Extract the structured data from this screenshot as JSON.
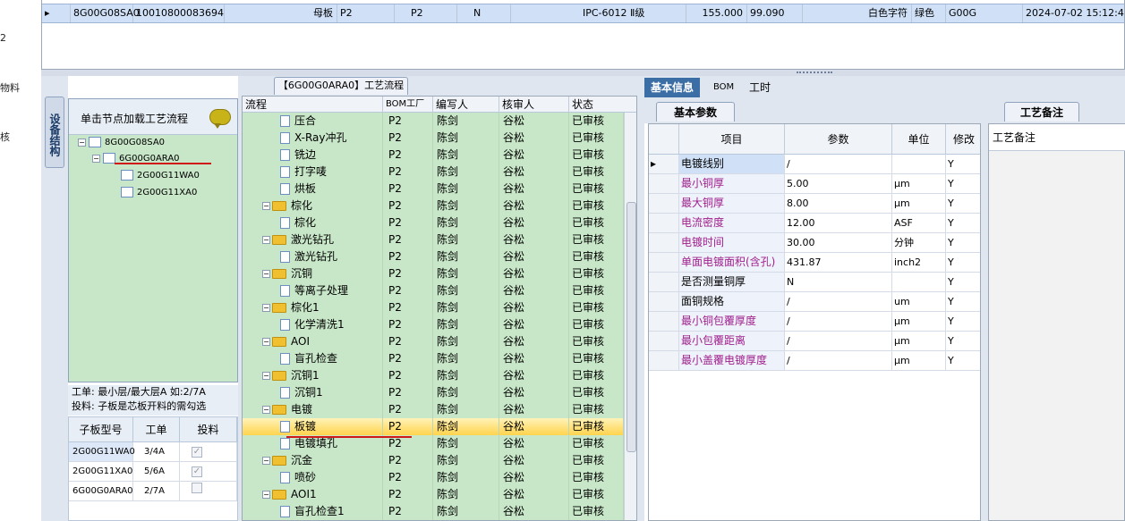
{
  "edge_fragments": [
    "2",
    "物料",
    "核"
  ],
  "top_row": {
    "indicator": "▸",
    "cells": [
      "8G00G08SA0",
      "10010800083694",
      "母板",
      "P2",
      "P2",
      "N",
      "IPC-6012 Ⅱ级",
      "155.000",
      "99.090",
      "白色字符",
      "绿色",
      "G00G",
      "2024-07-02 15:12:4"
    ]
  },
  "left_dock_tab": "设备结构",
  "tree": {
    "header": "单击节点加载工艺流程",
    "nodes": [
      {
        "label": "8G00G08SA0",
        "pm": "−"
      },
      {
        "label": "6G00G0ARA0",
        "pm": "−"
      },
      {
        "label": "2G00G11WA0",
        "pm": ""
      },
      {
        "label": "2G00G11XA0",
        "pm": ""
      }
    ]
  },
  "info_lines": [
    "工单: 最小层/最大层A 如:2/7A",
    "投料: 子板是芯板开料的需勾选"
  ],
  "sub_grid": {
    "headers": [
      "子板型号",
      "工单",
      "投料"
    ],
    "rows": [
      {
        "model": "2G00G11WA0",
        "order": "3/4A",
        "checked": "✓"
      },
      {
        "model": "2G00G11XA0",
        "order": "5/6A",
        "checked": "✓"
      },
      {
        "model": "6G00G0ARA0",
        "order": "2/7A",
        "checked": ""
      }
    ]
  },
  "process_title": "【6G00G0ARA0】工艺流程",
  "process": {
    "headers": [
      "流程",
      "BOM工厂",
      "编写人",
      "核审人",
      "状态"
    ],
    "rows": [
      {
        "name": "压合",
        "type": "leaf",
        "factory": "P2",
        "writer": "陈剑",
        "reviewer": "谷松",
        "status": "已审核"
      },
      {
        "name": "X-Ray冲孔",
        "type": "leaf",
        "factory": "P2",
        "writer": "陈剑",
        "reviewer": "谷松",
        "status": "已审核"
      },
      {
        "name": "铣边",
        "type": "leaf",
        "factory": "P2",
        "writer": "陈剑",
        "reviewer": "谷松",
        "status": "已审核"
      },
      {
        "name": "打字唛",
        "type": "leaf",
        "factory": "P2",
        "writer": "陈剑",
        "reviewer": "谷松",
        "status": "已审核"
      },
      {
        "name": "烘板",
        "type": "leaf",
        "factory": "P2",
        "writer": "陈剑",
        "reviewer": "谷松",
        "status": "已审核"
      },
      {
        "name": "棕化",
        "type": "group",
        "factory": "P2",
        "writer": "陈剑",
        "reviewer": "谷松",
        "status": "已审核"
      },
      {
        "name": "棕化",
        "type": "leaf",
        "factory": "P2",
        "writer": "陈剑",
        "reviewer": "谷松",
        "status": "已审核"
      },
      {
        "name": "激光钻孔",
        "type": "group",
        "factory": "P2",
        "writer": "陈剑",
        "reviewer": "谷松",
        "status": "已审核"
      },
      {
        "name": "激光钻孔",
        "type": "leaf",
        "factory": "P2",
        "writer": "陈剑",
        "reviewer": "谷松",
        "status": "已审核"
      },
      {
        "name": "沉铜",
        "type": "group",
        "factory": "P2",
        "writer": "陈剑",
        "reviewer": "谷松",
        "status": "已审核"
      },
      {
        "name": "等离子处理",
        "type": "leaf",
        "factory": "P2",
        "writer": "陈剑",
        "reviewer": "谷松",
        "status": "已审核"
      },
      {
        "name": "棕化1",
        "type": "group",
        "factory": "P2",
        "writer": "陈剑",
        "reviewer": "谷松",
        "status": "已审核"
      },
      {
        "name": "化学清洗1",
        "type": "leaf",
        "factory": "P2",
        "writer": "陈剑",
        "reviewer": "谷松",
        "status": "已审核"
      },
      {
        "name": "AOI",
        "type": "group",
        "factory": "P2",
        "writer": "陈剑",
        "reviewer": "谷松",
        "status": "已审核"
      },
      {
        "name": "盲孔检查",
        "type": "leaf",
        "factory": "P2",
        "writer": "陈剑",
        "reviewer": "谷松",
        "status": "已审核"
      },
      {
        "name": "沉铜1",
        "type": "group",
        "factory": "P2",
        "writer": "陈剑",
        "reviewer": "谷松",
        "status": "已审核"
      },
      {
        "name": "沉铜1",
        "type": "leaf",
        "factory": "P2",
        "writer": "陈剑",
        "reviewer": "谷松",
        "status": "已审核"
      },
      {
        "name": "电镀",
        "type": "group",
        "factory": "P2",
        "writer": "陈剑",
        "reviewer": "谷松",
        "status": "已审核"
      },
      {
        "name": "板镀",
        "type": "leaf",
        "factory": "P2",
        "writer": "陈剑",
        "reviewer": "谷松",
        "status": "已审核",
        "selected": true
      },
      {
        "name": "电镀填孔",
        "type": "leaf",
        "factory": "P2",
        "writer": "陈剑",
        "reviewer": "谷松",
        "status": "已审核"
      },
      {
        "name": "沉金",
        "type": "group",
        "factory": "P2",
        "writer": "陈剑",
        "reviewer": "谷松",
        "status": "已审核"
      },
      {
        "name": "喷砂",
        "type": "leaf",
        "factory": "P2",
        "writer": "陈剑",
        "reviewer": "谷松",
        "status": "已审核"
      },
      {
        "name": "AOI1",
        "type": "group",
        "factory": "P2",
        "writer": "陈剑",
        "reviewer": "谷松",
        "status": "已审核"
      },
      {
        "name": "盲孔检查1",
        "type": "leaf",
        "factory": "P2",
        "writer": "陈剑",
        "reviewer": "谷松",
        "status": "已审核"
      }
    ]
  },
  "right_tabs": [
    "基本信息",
    "BOM",
    "工时"
  ],
  "right_subtabs": {
    "basic": "基本参数",
    "note": "工艺备注"
  },
  "params": {
    "headers": [
      "项目",
      "参数",
      "单位",
      "修改"
    ],
    "rows": [
      {
        "item": "电镀线别",
        "value": "/",
        "unit": "",
        "mod": "Y",
        "color": "#000000"
      },
      {
        "item": "最小铜厚",
        "value": "5.00",
        "unit": "μm",
        "mod": "Y",
        "color": "#a0208c"
      },
      {
        "item": "最大铜厚",
        "value": "8.00",
        "unit": "μm",
        "mod": "Y",
        "color": "#a0208c"
      },
      {
        "item": "电流密度",
        "value": "12.00",
        "unit": "ASF",
        "mod": "Y",
        "color": "#a0208c"
      },
      {
        "item": "电镀时间",
        "value": "30.00",
        "unit": "分钟",
        "mod": "Y",
        "color": "#a0208c"
      },
      {
        "item": "单面电镀面积(含孔)",
        "value": "431.87",
        "unit": "inch2",
        "mod": "Y",
        "color": "#a0208c"
      },
      {
        "item": "是否测量铜厚",
        "value": "N",
        "unit": "",
        "mod": "Y",
        "color": "#000000"
      },
      {
        "item": "面铜规格",
        "value": "/",
        "unit": "um",
        "mod": "Y",
        "color": "#000000"
      },
      {
        "item": "最小铜包覆厚度",
        "value": "/",
        "unit": "μm",
        "mod": "Y",
        "color": "#a0208c"
      },
      {
        "item": "最小包覆距离",
        "value": "/",
        "unit": "μm",
        "mod": "Y",
        "color": "#a0208c"
      },
      {
        "item": "最小盖覆电镀厚度",
        "value": "/",
        "unit": "μm",
        "mod": "Y",
        "color": "#a0208c"
      }
    ]
  },
  "note_header": "工艺备注"
}
